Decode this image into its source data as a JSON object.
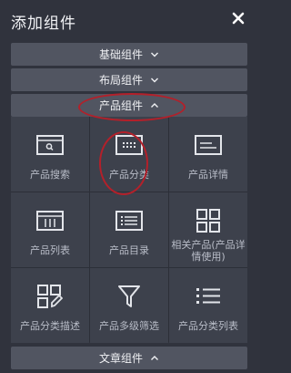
{
  "header": {
    "title": "添加组件"
  },
  "sections": {
    "basic": {
      "label": "基础组件"
    },
    "layout": {
      "label": "布局组件"
    },
    "product": {
      "label": "产品组件"
    },
    "article": {
      "label": "文章组件"
    }
  },
  "product_tiles": [
    {
      "label": "产品搜索",
      "icon": "product-search-icon"
    },
    {
      "label": "产品分类",
      "icon": "product-category-icon"
    },
    {
      "label": "产品详情",
      "icon": "product-detail-icon"
    },
    {
      "label": "产品列表",
      "icon": "product-list-icon"
    },
    {
      "label": "产品目录",
      "icon": "product-catalog-icon"
    },
    {
      "label": "相关产品(产品详情使用)",
      "icon": "related-products-icon"
    },
    {
      "label": "产品分类描述",
      "icon": "category-description-icon"
    },
    {
      "label": "产品多级筛选",
      "icon": "multi-filter-icon"
    },
    {
      "label": "产品分类列表",
      "icon": "category-list-icon"
    }
  ],
  "colors": {
    "highlight": "#b3202a",
    "background": "#30333d",
    "section": "#515561"
  }
}
